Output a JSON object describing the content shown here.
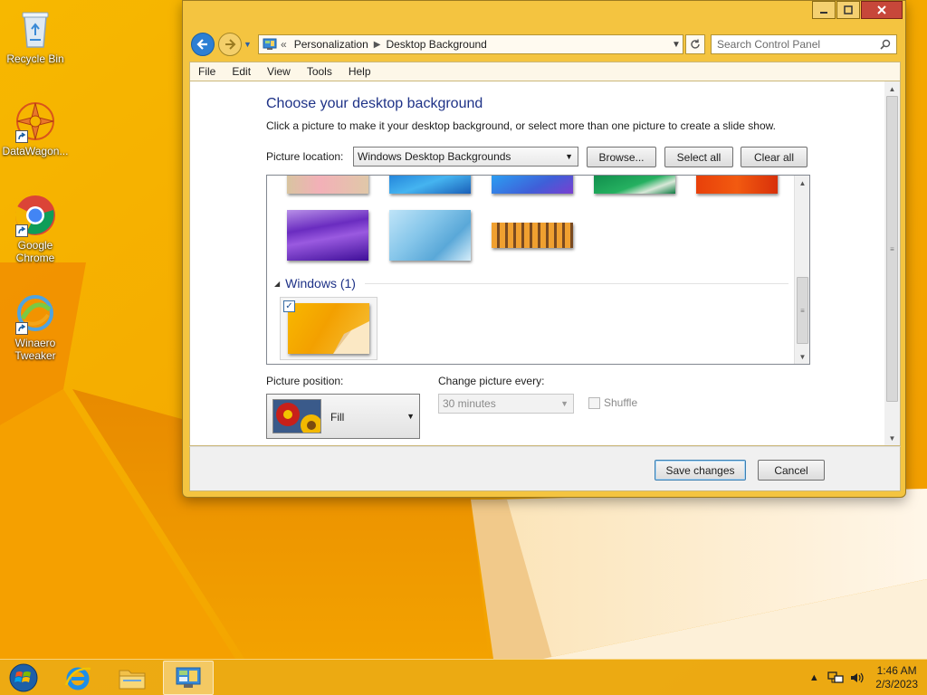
{
  "desktop": {
    "icons": [
      {
        "label": "Recycle Bin"
      },
      {
        "label": "DataWagon..."
      },
      {
        "label": "Google Chrome"
      },
      {
        "label": "Winaero Tweaker"
      }
    ]
  },
  "window": {
    "address": {
      "overflow": "«",
      "crumbs": [
        "Personalization",
        "Desktop Background"
      ]
    },
    "search": {
      "placeholder": "Search Control Panel"
    },
    "menu": [
      "File",
      "Edit",
      "View",
      "Tools",
      "Help"
    ],
    "page": {
      "title": "Choose your desktop background",
      "description": "Click a picture to make it your desktop background, or select more than one picture to create a slide show.",
      "picture_location_label": "Picture location:",
      "picture_location_value": "Windows Desktop Backgrounds",
      "browse_label": "Browse...",
      "select_all_label": "Select all",
      "clear_all_label": "Clear all",
      "group_title": "Windows (1)",
      "picture_position_label": "Picture position:",
      "picture_position_value": "Fill",
      "change_every_label": "Change picture every:",
      "change_every_value": "30 minutes",
      "shuffle_label": "Shuffle"
    },
    "footer": {
      "save_label": "Save changes",
      "cancel_label": "Cancel"
    }
  },
  "taskbar": {
    "clock_time": "1:46 AM",
    "clock_date": "2/3/2023"
  },
  "colors": {
    "accent_blue": "#2d7fd3",
    "title_blue": "#1e3287",
    "desktop_orange": "#f5a800"
  }
}
